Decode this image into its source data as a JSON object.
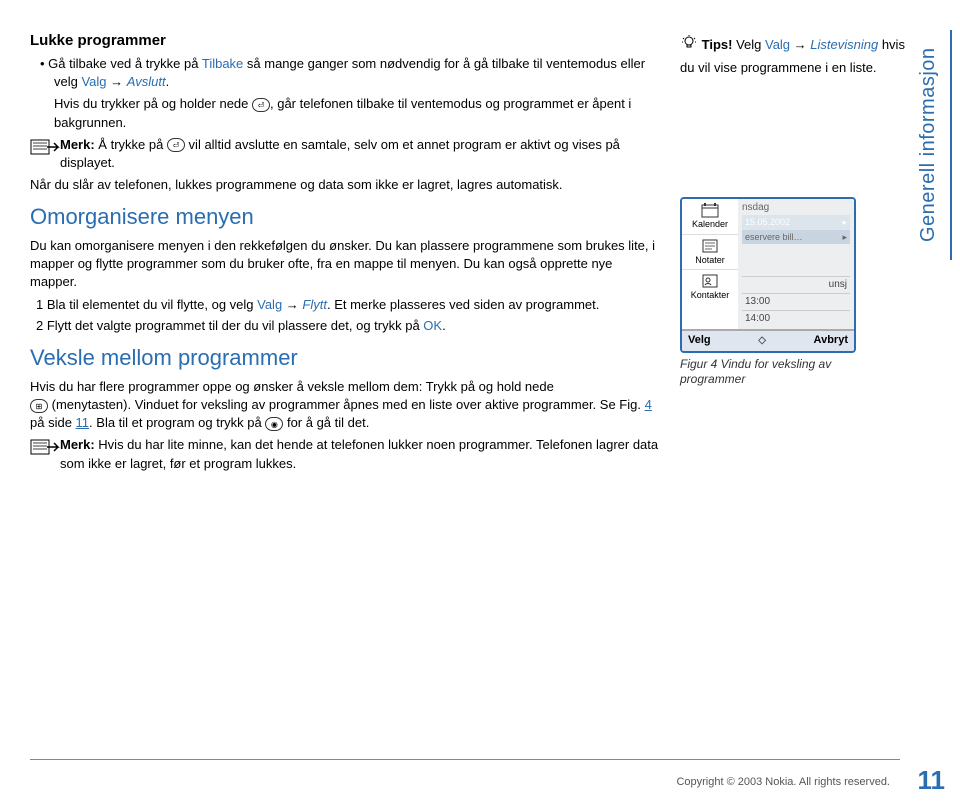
{
  "rightTab": "Generell informasjon",
  "main": {
    "lukke": {
      "title": "Lukke programmer",
      "bullet_pre": "Gå tilbake ved å trykke på ",
      "tilbake": "Tilbake",
      "bullet_mid": " så mange ganger som nødvendig for å gå tilbake til ventemodus eller velg ",
      "valg": "Valg",
      "arrow": "→",
      "avslutt": "Avslutt",
      "bullet_post": ".",
      "hvis": "Hvis du trykker på og holder nede ",
      "hvis_tail": ", går telefonen tilbake til ventemodus og programmet er åpent i bakgrunnen.",
      "merk_pre": "Merk: ",
      "merk_mid1": "Å trykke på ",
      "merk_mid2": " vil alltid avslutte en samtale, selv om et annet program er aktivt og vises på displayet.",
      "nar": "Når du slår av telefonen, lukkes programmene og data som ikke er lagret, lagres automatisk."
    },
    "om": {
      "title": "Omorganisere menyen",
      "p1": "Du kan omorganisere menyen i den rekkefølgen du ønsker. Du kan plassere programmene som brukes lite, i mapper og flytte programmer som du bruker ofte, fra en mappe til menyen. Du kan også opprette nye mapper.",
      "l1_pre": "1  Bla til elementet du vil flytte, og velg ",
      "l1_valg": "Valg",
      "l1_arrow": " → ",
      "l1_flytt": "Flytt",
      "l1_post": ". Et merke plasseres ved siden av programmet.",
      "l2_pre": "2  Flytt det valgte programmet til der du vil plassere det, og trykk på ",
      "l2_ok": "OK",
      "l2_post": "."
    },
    "veksle": {
      "title": "Veksle mellom programmer",
      "p_pre": "Hvis du har flere programmer oppe og ønsker å veksle mellom dem: Trykk på og hold nede ",
      "p_mid": " (menytasten). Vinduet for veksling av programmer åpnes med en liste over aktive programmer. Se Fig. ",
      "fig": "4",
      "p_side_pre": " på side ",
      "side": "11",
      "p_tail_pre": ". Bla til et program og trykk på ",
      "p_tail_post": " for å gå til det.",
      "merk_pre": "Merk: ",
      "merk_text": "Hvis du har lite minne, kan det hende at telefonen lukker noen programmer. Telefonen lagrer data som ikke er lagret, før et program lukkes."
    }
  },
  "tip": {
    "lead": "Tips! ",
    "text1": "Velg ",
    "valg": "Valg",
    "arrow": " → ",
    "liste": "Listevisning",
    "tail": " hvis du vil vise programmene i en liste."
  },
  "phone": {
    "day": "nsdag",
    "date": "15.05.2002",
    "entry": "eservere bill…",
    "entry_mark": "▸",
    "items": [
      "Kalender",
      "Notater",
      "Kontakter"
    ],
    "time_hint": "unsj",
    "times": [
      "13:00",
      "14:00"
    ],
    "sk_left": "Velg",
    "sk_right": "Avbryt"
  },
  "caption": "Figur 4 Vindu for veksling av programmer",
  "footer": "Copyright © 2003 Nokia. All rights reserved.",
  "pageNumber": "11"
}
